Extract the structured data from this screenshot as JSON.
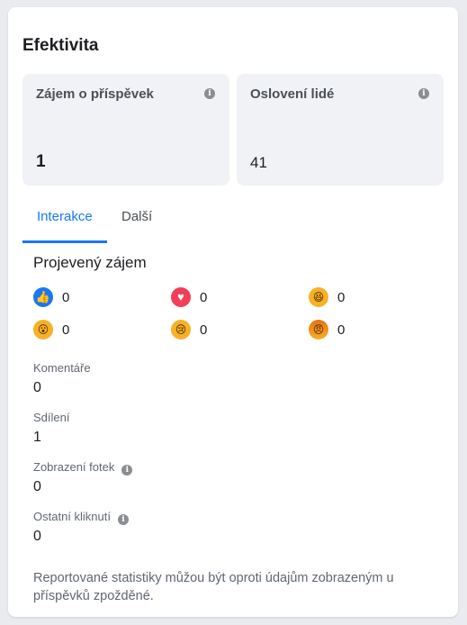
{
  "title": "Efektivita",
  "stats": [
    {
      "label": "Zájem o příspěvek",
      "value": "1"
    },
    {
      "label": "Oslovení lidé",
      "value": "41"
    }
  ],
  "info_glyph": "i",
  "tabs": [
    {
      "label": "Interakce"
    },
    {
      "label": "Další"
    }
  ],
  "section_title": "Projevený zájem",
  "reactions": [
    {
      "icon": "like-icon",
      "glyph": "👍",
      "count": "0"
    },
    {
      "icon": "love-icon",
      "glyph": "♥",
      "count": "0"
    },
    {
      "icon": "haha-icon",
      "glyph": "😆",
      "count": "0"
    },
    {
      "icon": "wow-icon",
      "glyph": "😮",
      "count": "0"
    },
    {
      "icon": "sad-icon",
      "glyph": "😢",
      "count": "0"
    },
    {
      "icon": "angry-icon",
      "glyph": "😠",
      "count": "0"
    }
  ],
  "metrics": [
    {
      "label": "Komentáře",
      "value": "0"
    },
    {
      "label": "Sdílení",
      "value": "1"
    },
    {
      "label": "Zobrazení fotek",
      "value": "0"
    },
    {
      "label": "Ostatní kliknutí",
      "value": "0"
    }
  ],
  "footnote": "Reportované statistiky můžou být oproti údajům zobrazeným u příspěvků zpožděné.",
  "colors": {
    "accent": "#1877f2",
    "tile_bg": "#f0f2f5"
  }
}
